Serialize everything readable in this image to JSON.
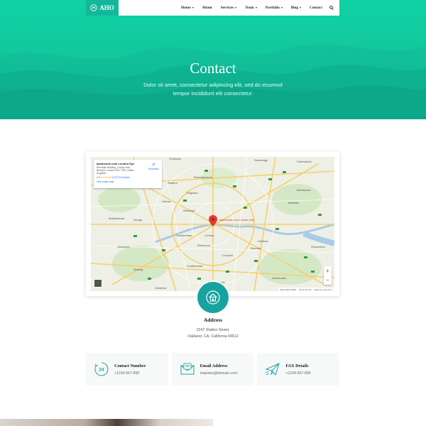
{
  "brand": {
    "name": "AHO",
    "color": "#13b89a"
  },
  "nav": {
    "items": [
      {
        "label": "Home",
        "dropdown": true
      },
      {
        "label": "About",
        "dropdown": false
      },
      {
        "label": "Services",
        "dropdown": true
      },
      {
        "label": "Team",
        "dropdown": true
      },
      {
        "label": "Portfolio",
        "dropdown": true
      },
      {
        "label": "Blog",
        "dropdown": true
      },
      {
        "label": "Contact",
        "dropdown": false
      }
    ],
    "search_icon": "search-icon"
  },
  "hero": {
    "title": "Contact",
    "subtitle": "Dolor sit amet, consectetur adipiscing elit, sed do eiusmod tempor incididunt elit consectetur."
  },
  "map": {
    "place_name": "lastminute.com London Eye",
    "place_address": "Riverside Building, County Hall, Bishop's, London SE1 7PB, United Kingdom",
    "rating": "4.5",
    "stars": "★★★★★",
    "reviews": "123,079 reviews",
    "larger_map": "View larger map",
    "directions": "Directions",
    "marker_label": "lastminute.com London Eye",
    "zoom_in": "+",
    "zoom_out": "−",
    "footer": [
      "Map data ©2020",
      "Terms of Use",
      "Report a map error"
    ],
    "towns": [
      "St Albans",
      "Chelmsford",
      "Watford",
      "Borehamwood",
      "Edgware",
      "Brentwood",
      "Basildon",
      "Harrow",
      "Wembley",
      "Slough",
      "Maidenhead",
      "London",
      "Twickenham",
      "Richmond",
      "Croydon",
      "Dartford",
      "Bromley",
      "Bracknell",
      "Woking",
      "Leatherhead",
      "Guildford",
      "Reigate",
      "Sevenoaks",
      "Gravesend",
      "Stevenage"
    ]
  },
  "address": {
    "title": "Address",
    "line1": "2247  Station Street,",
    "line2": "Oakland, CA, California 94612"
  },
  "contacts": [
    {
      "title": "Contact Number",
      "value": "+1234-567-890",
      "icon": "phone-24-icon"
    },
    {
      "title": "Email Address",
      "value": "inquiries@domain.com",
      "icon": "mail-icon"
    },
    {
      "title": "FAX Details",
      "value": "+1234-567-890",
      "icon": "paper-plane-icon"
    }
  ],
  "colors": {
    "accent": "#13c79c",
    "teal": "#17a3a0"
  }
}
